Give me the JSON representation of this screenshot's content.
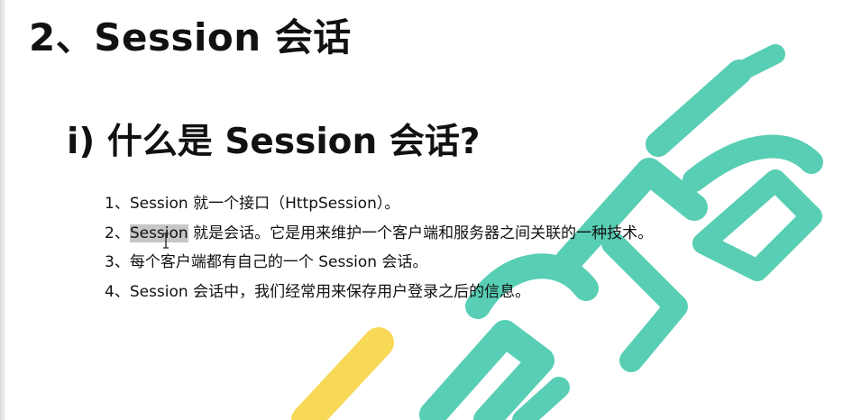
{
  "page": {
    "title": "2、Session 会话",
    "heading": "i) 什么是 Session 会话?"
  },
  "items": [
    {
      "text": "1、Session 就一个接口（HttpSession）。"
    },
    {
      "prefix": "2、",
      "highlight": "Session",
      "text": " 就是会话。它是用来维护一个客户端和服务器之间关联的一种技术。"
    },
    {
      "text": "3、每个客户端都有自己的一个 Session 会话。"
    },
    {
      "text": "4、Session 会话中，我们经常用来保存用户登录之后的信息。"
    }
  ],
  "watermark": {
    "name": "watermark-logo",
    "colors": [
      "#3cc6a8",
      "#f7d23a"
    ]
  },
  "cursor": {
    "name": "text-cursor-icon"
  }
}
